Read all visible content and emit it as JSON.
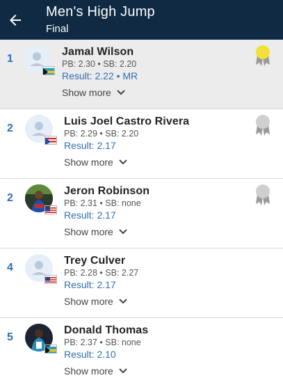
{
  "header": {
    "title": "Men's High Jump",
    "subtitle": "Final"
  },
  "colors": {
    "header_bg": "#102a44",
    "accent": "#2f6fb3",
    "gold": "#f3e03a",
    "silver": "#cfcfcf"
  },
  "show_more_label": "Show more",
  "entries": [
    {
      "rank": "1",
      "name": "Jamal Wilson",
      "stats": "PB: 2.30 • SB: 2.20",
      "result": "Result: 2.22 • MR",
      "flag": "bahamas",
      "medal": "gold"
    },
    {
      "rank": "2",
      "name": "Luis Joel Castro Rivera",
      "stats": "PB: 2.29 • SB: 2.20",
      "result": "Result: 2.17",
      "flag": "puerto-rico",
      "medal": "silver"
    },
    {
      "rank": "2",
      "name": "Jeron Robinson",
      "stats": "PB: 2.31 • SB: none",
      "result": "Result: 2.17",
      "flag": "usa",
      "medal": "silver"
    },
    {
      "rank": "4",
      "name": "Trey Culver",
      "stats": "PB: 2.28 • SB: 2.27",
      "result": "Result: 2.17",
      "flag": "usa",
      "medal": ""
    },
    {
      "rank": "5",
      "name": "Donald Thomas",
      "stats": "PB: 2.37 • SB: none",
      "result": "Result: 2.10",
      "flag": "bahamas",
      "medal": ""
    }
  ]
}
